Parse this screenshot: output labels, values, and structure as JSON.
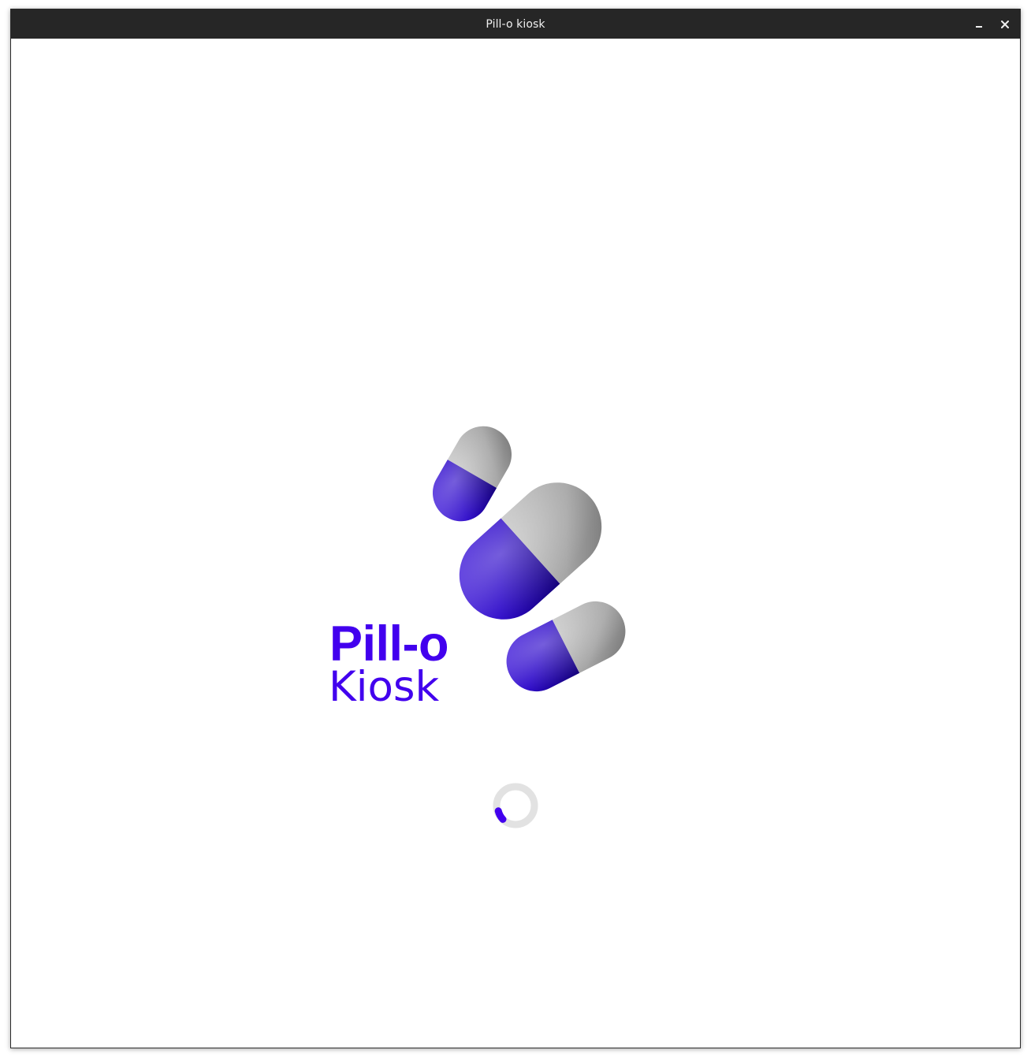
{
  "window": {
    "title": "Pill-o kiosk"
  },
  "titlebar": {
    "minimize_icon": "minimize-icon",
    "close_icon": "close-icon"
  },
  "brand": {
    "name_line1": "Pill-o",
    "name_line2": "Kiosk"
  },
  "colors": {
    "brand_purple": "#4200ee",
    "capsule_blue": "#2a06c8",
    "capsule_gray": "#a3a3a3",
    "spinner_track": "#e2e2e2",
    "titlebar": "#262626"
  },
  "icons": {
    "logo": "pill-capsules-logo",
    "spinner": "loading-spinner-icon"
  }
}
